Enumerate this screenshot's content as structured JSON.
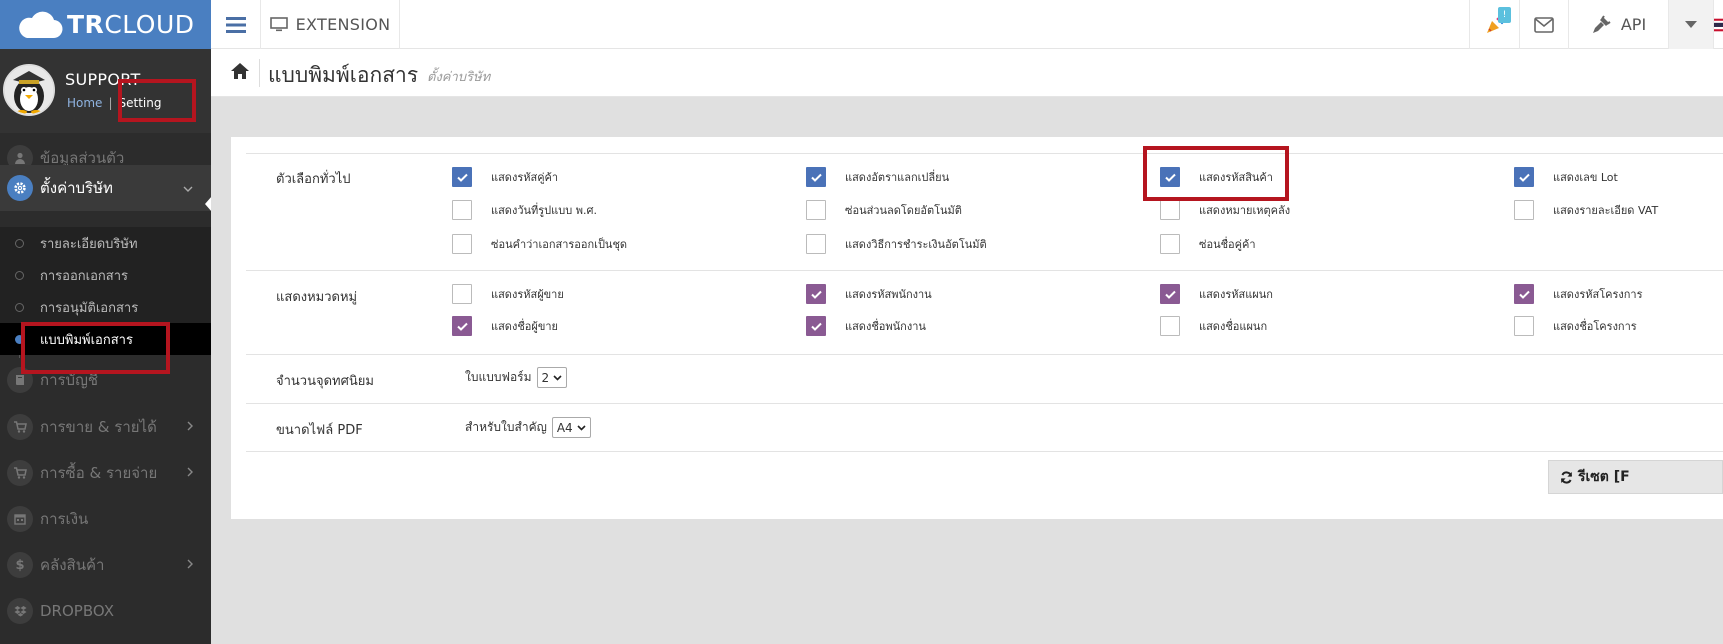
{
  "topbar": {
    "brand_bold": "TR",
    "brand_light": "CLOUD",
    "extension_label": "EXTENSION",
    "notification_count": "!",
    "api_label": "API"
  },
  "user": {
    "name": "SUPPORT",
    "home_link": "Home",
    "separator": "|",
    "setting_link": "Setting"
  },
  "sidebar": {
    "items": [
      {
        "label": "ข้อมูลส่วนตัว",
        "icon": "user-icon"
      },
      {
        "label": "ตั้งค่าบริษัท",
        "icon": "gear-icon"
      },
      {
        "label": "การบัญชี",
        "icon": "book-icon"
      },
      {
        "label": "การขาย & รายได้",
        "icon": "cart-icon"
      },
      {
        "label": "การซื้อ & รายจ่าย",
        "icon": "cart-icon"
      },
      {
        "label": "การเงิน",
        "icon": "calendar-icon"
      },
      {
        "label": "คลังสินค้า",
        "icon": "dollar-icon"
      },
      {
        "label": "DROPBOX",
        "icon": "dropbox-icon"
      }
    ],
    "subitems": [
      {
        "label": "รายละเอียดบริษัท"
      },
      {
        "label": "การออกเอกสาร"
      },
      {
        "label": "การอนุมัติเอกสาร"
      },
      {
        "label": "แบบพิมพ์เอกสาร"
      }
    ]
  },
  "page": {
    "title": "แบบพิมพ์เอกสาร",
    "subtitle": "ตั้งค่าบริษัท"
  },
  "sections": {
    "general": {
      "label": "ตัวเลือกทั่วไป",
      "options": [
        {
          "label": "แสดงรหัสคู่ค้า",
          "checked": true
        },
        {
          "label": "แสดงอัตราแลกเปลี่ยน",
          "checked": true
        },
        {
          "label": "แสดงรหัสสินค้า",
          "checked": true
        },
        {
          "label": "แสดงเลข Lot",
          "checked": true
        },
        {
          "label": "แสดงวันที่รูปแบบ พ.ศ.",
          "checked": false
        },
        {
          "label": "ซ่อนส่วนลดโดยอัตโนมัติ",
          "checked": false
        },
        {
          "label": "แสดงหมายเหตุคลัง",
          "checked": false
        },
        {
          "label": "แสดงรายละเอียด VAT",
          "checked": false
        },
        {
          "label": "ซ่อนคำว่าเอกสารออกเป็นชุด",
          "checked": false
        },
        {
          "label": "แสดงวิธีการชำระเงินอัตโนมัติ",
          "checked": false
        },
        {
          "label": "ซ่อนชื่อคู่ค้า",
          "checked": false
        }
      ]
    },
    "category": {
      "label": "แสดงหมวดหมู่",
      "options": [
        {
          "label": "แสดงรหัสผู้ขาย",
          "checked": false
        },
        {
          "label": "แสดงรหัสพนักงาน",
          "checked": true
        },
        {
          "label": "แสดงรหัสแผนก",
          "checked": true
        },
        {
          "label": "แสดงรหัสโครงการ",
          "checked": true
        },
        {
          "label": "แสดงชื่อผู้ขาย",
          "checked": true
        },
        {
          "label": "แสดงชื่อพนักงาน",
          "checked": true
        },
        {
          "label": "แสดงชื่อแผนก",
          "checked": false
        },
        {
          "label": "แสดงชื่อโครงการ",
          "checked": false
        }
      ]
    },
    "decimals": {
      "label": "จำนวนจุดทศนิยม",
      "field_label": "ใบแบบฟอร์ม",
      "value": "2"
    },
    "pdf_size": {
      "label": "ขนาดไฟล์ PDF",
      "field_label": "สำหรับใบสำคัญ",
      "value": "A4"
    }
  },
  "reset_label": "รีเซต [F",
  "colors": {
    "brand_blue": "#4a7fc1",
    "checkbox_blue": "#4a72b8",
    "checkbox_purple": "#8a5a93",
    "annotation_red": "#b5151f"
  }
}
